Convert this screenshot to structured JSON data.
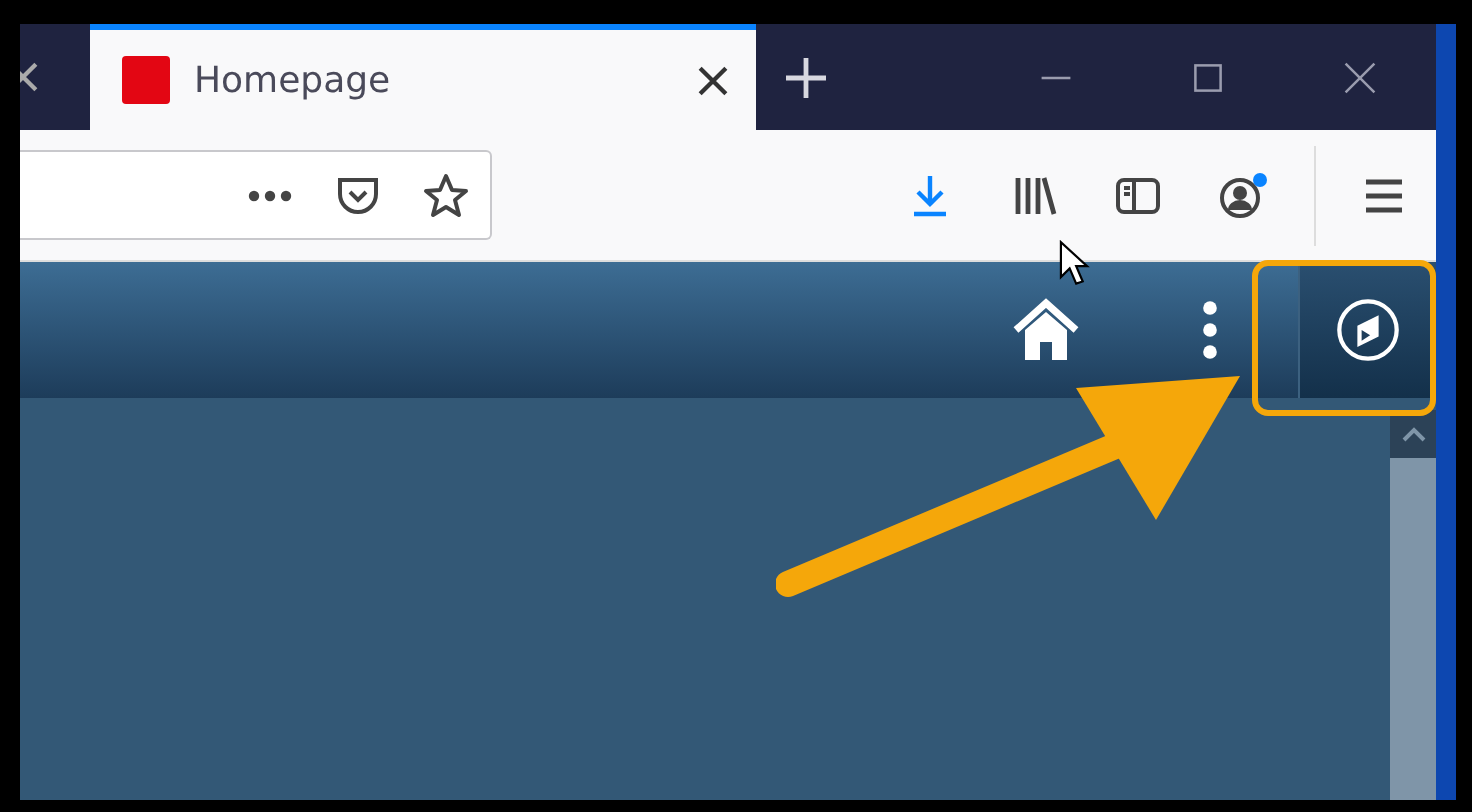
{
  "browser": {
    "tabs": [
      {
        "selected": false
      },
      {
        "title": "Homepage",
        "selected": true
      }
    ],
    "account": {
      "notification": true
    }
  },
  "app_header": {
    "compass_button": {
      "highlighted": true
    }
  }
}
